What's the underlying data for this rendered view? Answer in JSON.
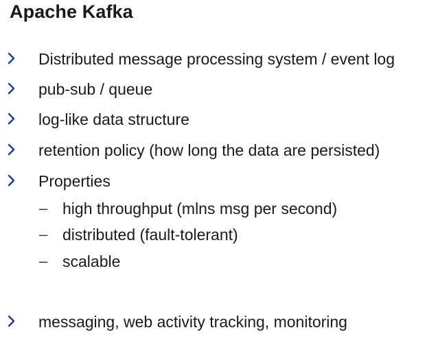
{
  "title": "Apache Kafka",
  "accent_color": "#1f3a8a",
  "bullet_icon": "chevron-right-icon",
  "sub_bullet_icon": "dash-icon",
  "bullets": [
    "Distributed message processing system / event log",
    "pub-sub / queue",
    "log-like data structure",
    "retention policy (how long the data are persisted)",
    "Properties"
  ],
  "sub_bullets": [
    "high throughput (mlns msg per second)",
    "distributed (fault-tolerant)",
    "scalable"
  ],
  "sub_dash": "–",
  "last_bullet": "messaging, web activity tracking, monitoring"
}
